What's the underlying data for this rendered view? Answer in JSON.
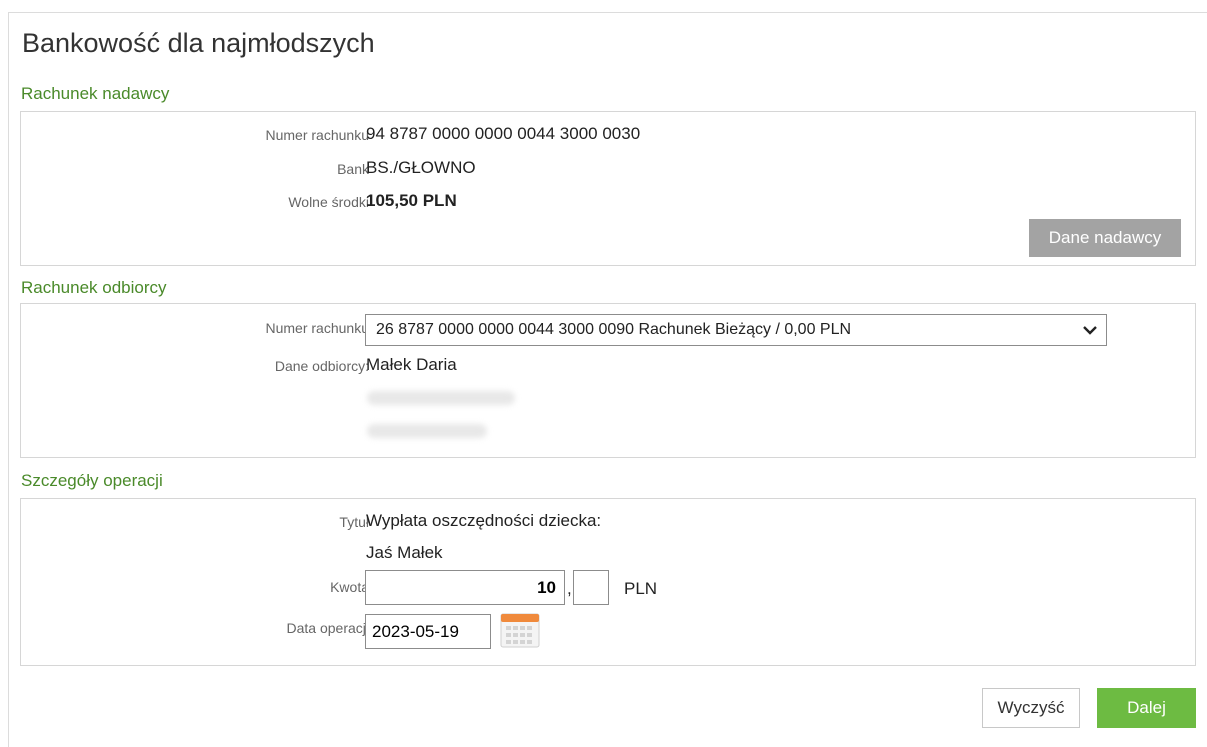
{
  "page": {
    "title": "Bankowość dla najmłodszych"
  },
  "sender": {
    "section_title": "Rachunek nadawcy",
    "account_label": "Numer rachunku",
    "account_value": "94 8787 0000 0000 0044 3000 0030",
    "bank_label": "Bank",
    "bank_value": "BS./GŁOWNO",
    "funds_label": "Wolne środki",
    "funds_value": "105,50 PLN",
    "details_button": "Dane nadawcy"
  },
  "recipient": {
    "section_title": "Rachunek odbiorcy",
    "account_label": "Numer rachunku",
    "account_selected": "26 8787 0000 0000 0044 3000 0090 Rachunek Bieżący / 0,00 PLN",
    "data_label": "Dane odbiorcy:",
    "name": "Małek Daria"
  },
  "operation": {
    "section_title": "Szczegóły operacji",
    "title_label": "Tytuł",
    "title_line1": "Wypłata oszczędności dziecka:",
    "title_line2": "Jaś Małek",
    "amount_label": "Kwota",
    "amount_whole": "10",
    "amount_separator": ",",
    "amount_cents": "",
    "currency": "PLN",
    "date_label": "Data operacji",
    "date_value": "2023-05-19"
  },
  "actions": {
    "clear": "Wyczyść",
    "next": "Dalej"
  },
  "colors": {
    "section": "#4a8a2a",
    "next_button": "#6dbb42",
    "gray_button": "#a3a3a3"
  },
  "icons": {
    "select_arrow": "chevron-down-icon",
    "date_picker": "calendar-icon"
  }
}
